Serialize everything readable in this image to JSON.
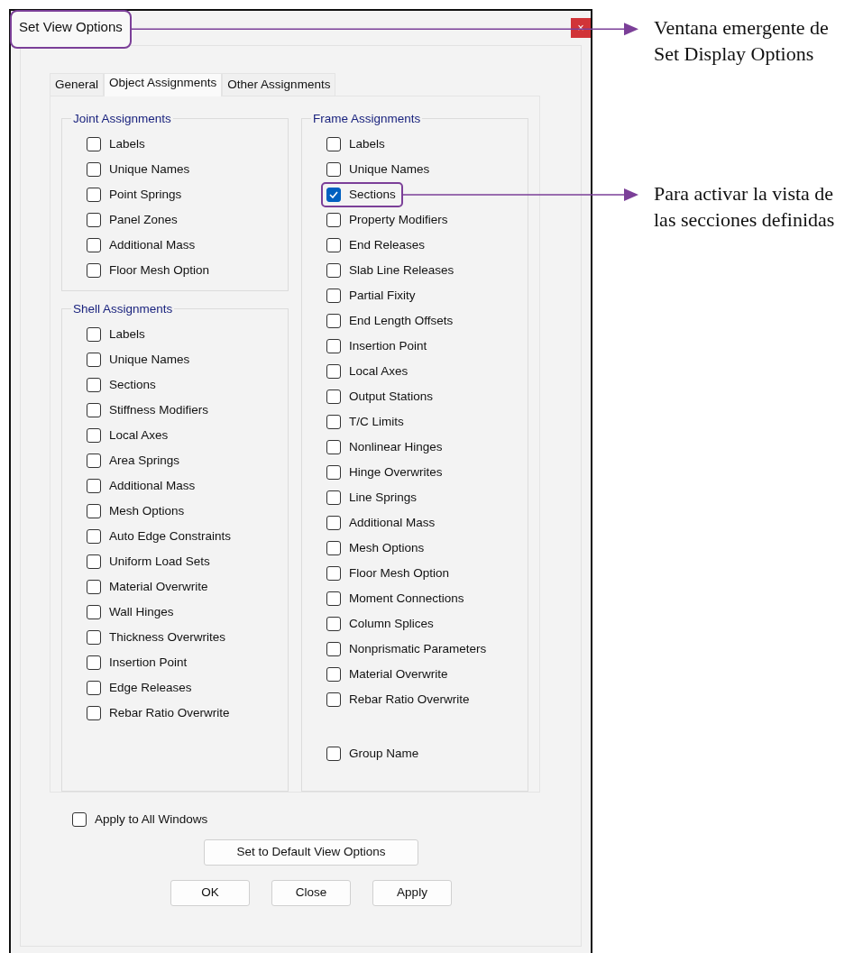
{
  "window": {
    "title": "Set View Options",
    "title_highlighted": true,
    "close": "×"
  },
  "tabs": [
    {
      "label": "General",
      "selected": false
    },
    {
      "label": "Object Assignments",
      "selected": true
    },
    {
      "label": "Other Assignments",
      "selected": false
    }
  ],
  "joint_assignments": {
    "title": "Joint Assignments",
    "items": [
      {
        "label": "Labels",
        "checked": false
      },
      {
        "label": "Unique Names",
        "checked": false
      },
      {
        "label": "Point Springs",
        "checked": false
      },
      {
        "label": "Panel Zones",
        "checked": false
      },
      {
        "label": "Additional Mass",
        "checked": false
      },
      {
        "label": "Floor Mesh Option",
        "checked": false
      }
    ]
  },
  "shell_assignments": {
    "title": "Shell Assignments",
    "items": [
      {
        "label": "Labels",
        "checked": false
      },
      {
        "label": "Unique Names",
        "checked": false
      },
      {
        "label": "Sections",
        "checked": false
      },
      {
        "label": "Stiffness Modifiers",
        "checked": false
      },
      {
        "label": "Local Axes",
        "checked": false
      },
      {
        "label": "Area Springs",
        "checked": false
      },
      {
        "label": "Additional Mass",
        "checked": false
      },
      {
        "label": "Mesh Options",
        "checked": false
      },
      {
        "label": "Auto Edge Constraints",
        "checked": false
      },
      {
        "label": "Uniform Load Sets",
        "checked": false
      },
      {
        "label": "Material Overwrite",
        "checked": false
      },
      {
        "label": "Wall Hinges",
        "checked": false
      },
      {
        "label": "Thickness Overwrites",
        "checked": false
      },
      {
        "label": "Insertion Point",
        "checked": false
      },
      {
        "label": "Edge Releases",
        "checked": false
      },
      {
        "label": "Rebar Ratio Overwrite",
        "checked": false
      }
    ]
  },
  "frame_assignments": {
    "title": "Frame Assignments",
    "items": [
      {
        "label": "Labels",
        "checked": false,
        "highlighted": false
      },
      {
        "label": "Unique Names",
        "checked": false,
        "highlighted": false
      },
      {
        "label": "Sections",
        "checked": true,
        "highlighted": true
      },
      {
        "label": "Property Modifiers",
        "checked": false,
        "highlighted": false
      },
      {
        "label": "End Releases",
        "checked": false,
        "highlighted": false
      },
      {
        "label": "Slab Line Releases",
        "checked": false,
        "highlighted": false
      },
      {
        "label": "Partial Fixity",
        "checked": false,
        "highlighted": false
      },
      {
        "label": "End Length Offsets",
        "checked": false,
        "highlighted": false
      },
      {
        "label": "Insertion Point",
        "checked": false,
        "highlighted": false
      },
      {
        "label": "Local Axes",
        "checked": false,
        "highlighted": false
      },
      {
        "label": "Output Stations",
        "checked": false,
        "highlighted": false
      },
      {
        "label": "T/C Limits",
        "checked": false,
        "highlighted": false
      },
      {
        "label": "Nonlinear Hinges",
        "checked": false,
        "highlighted": false
      },
      {
        "label": "Hinge Overwrites",
        "checked": false,
        "highlighted": false
      },
      {
        "label": "Line Springs",
        "checked": false,
        "highlighted": false
      },
      {
        "label": "Additional Mass",
        "checked": false,
        "highlighted": false
      },
      {
        "label": "Mesh Options",
        "checked": false,
        "highlighted": false
      },
      {
        "label": "Floor Mesh Option",
        "checked": false,
        "highlighted": false
      },
      {
        "label": "Moment Connections",
        "checked": false,
        "highlighted": false
      },
      {
        "label": "Column Splices",
        "checked": false,
        "highlighted": false
      },
      {
        "label": "Nonprismatic Parameters",
        "checked": false,
        "highlighted": false
      },
      {
        "label": "Material Overwrite",
        "checked": false,
        "highlighted": false
      },
      {
        "label": "Rebar Ratio Overwrite",
        "checked": false,
        "highlighted": false
      }
    ],
    "extra_items": [
      {
        "label": "Group Name",
        "checked": false
      }
    ]
  },
  "apply_to_all": {
    "label": "Apply to All Windows",
    "checked": false
  },
  "default_button": "Set to Default View Options",
  "buttons": [
    "OK",
    "Close",
    "Apply"
  ],
  "callouts": [
    {
      "text": "Ventana emergente de Set Display Options"
    },
    {
      "text": "Para activar la vista de las secciones definidas"
    }
  ]
}
